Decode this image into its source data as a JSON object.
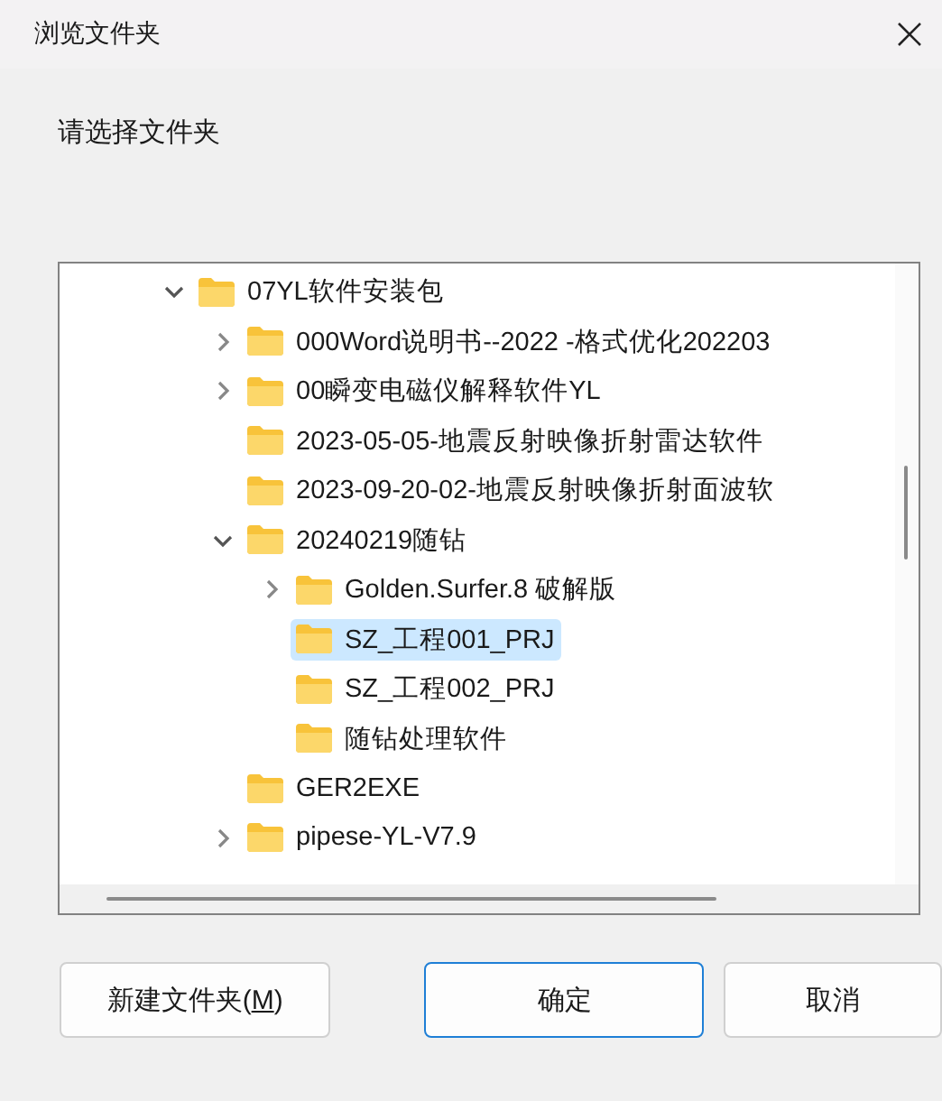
{
  "window": {
    "title": "浏览文件夹"
  },
  "prompt": "请选择文件夹",
  "tree": [
    {
      "label": "07YL软件安装包",
      "expandable": true,
      "expanded": true,
      "selected": false,
      "children": [
        {
          "label": "000Word说明书--2022 -格式优化202203",
          "expandable": true,
          "expanded": false,
          "selected": false
        },
        {
          "label": "00瞬变电磁仪解释软件YL",
          "expandable": true,
          "expanded": false,
          "selected": false
        },
        {
          "label": "2023-05-05-地震反射映像折射雷达软件",
          "expandable": false,
          "selected": false
        },
        {
          "label": "2023-09-20-02-地震反射映像折射面波软",
          "expandable": false,
          "selected": false
        },
        {
          "label": "20240219随钻",
          "expandable": true,
          "expanded": true,
          "selected": false,
          "children": [
            {
              "label": "Golden.Surfer.8 破解版",
              "expandable": true,
              "expanded": false,
              "selected": false
            },
            {
              "label": "SZ_工程001_PRJ",
              "expandable": false,
              "selected": true
            },
            {
              "label": "SZ_工程002_PRJ",
              "expandable": false,
              "selected": false
            },
            {
              "label": "随钻处理软件",
              "expandable": false,
              "selected": false
            }
          ]
        },
        {
          "label": "GER2EXE",
          "expandable": false,
          "selected": false
        },
        {
          "label": "pipese-YL-V7.9",
          "expandable": true,
          "expanded": false,
          "selected": false
        }
      ]
    }
  ],
  "buttons": [
    {
      "label_before": "新建文件夹(",
      "access_key": "M",
      "label_after": ")",
      "default": false
    },
    {
      "label_before": "确定",
      "default": true
    },
    {
      "label_before": "取消",
      "default": false
    }
  ]
}
